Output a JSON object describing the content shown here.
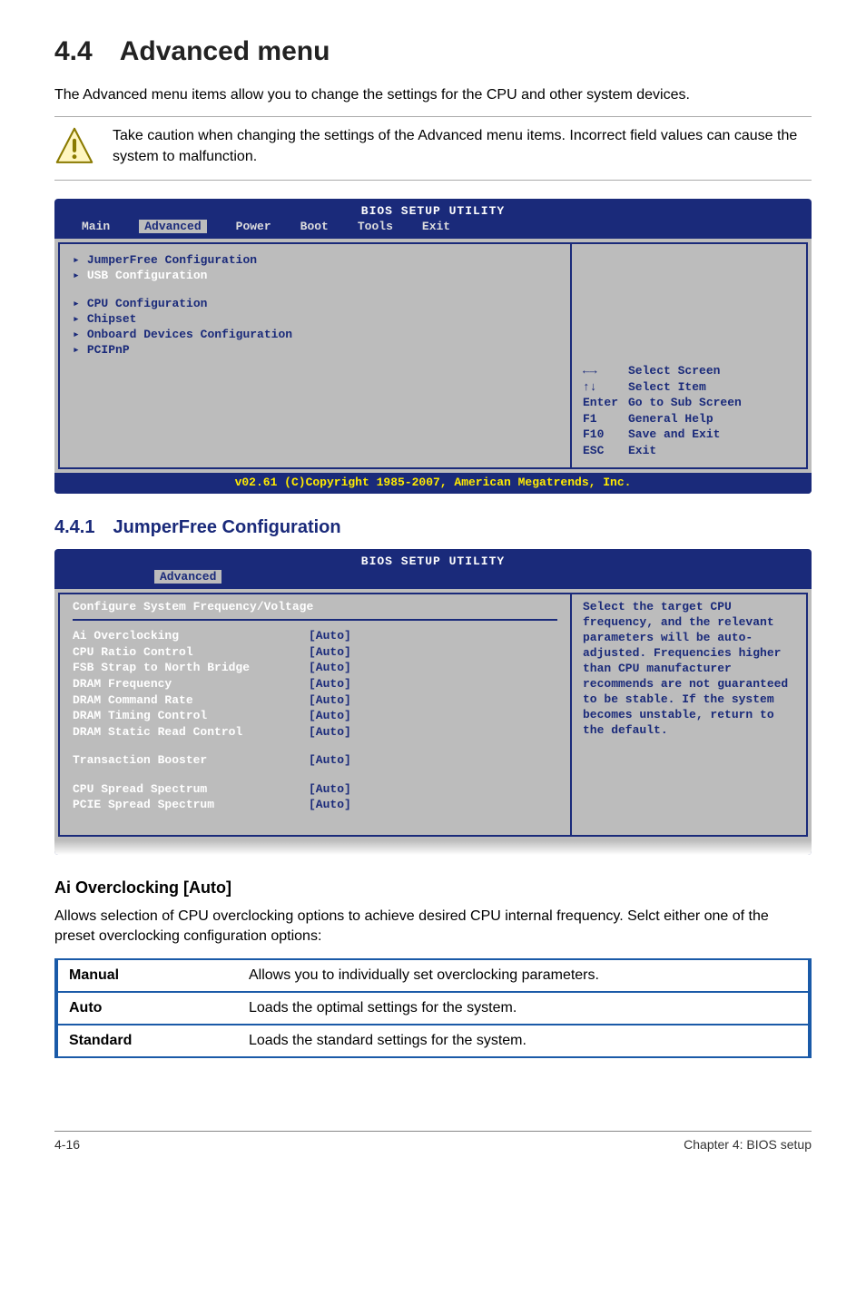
{
  "headings": {
    "main": "4.4 Advanced menu",
    "sub1": "4.4.1 JumperFree Configuration",
    "itemHeading": "Ai Overclocking [Auto]"
  },
  "paragraphs": {
    "intro": "The Advanced menu items allow you to change the settings for the CPU and other system devices.",
    "caution": "Take caution when changing the settings of the Advanced menu items. Incorrect field values can cause the system to malfunction.",
    "overclockDesc": "Allows selection of CPU overclocking options to achieve desired CPU internal frequency. Selct either one of the preset overclocking configuration options:"
  },
  "bios1": {
    "title": "BIOS SETUP UTILITY",
    "tabs": [
      "Main",
      "Advanced",
      "Power",
      "Boot",
      "Tools",
      "Exit"
    ],
    "activeTab": "Advanced",
    "left": [
      "JumperFree Configuration",
      "USB Configuration",
      "",
      "CPU Configuration",
      "Chipset",
      "Onboard Devices Configuration",
      "PCIPnP"
    ],
    "highlight": "USB Configuration",
    "help": [
      [
        "←→",
        "Select Screen"
      ],
      [
        "↑↓",
        "Select Item"
      ],
      [
        "Enter",
        "Go to Sub Screen"
      ],
      [
        "F1",
        "General Help"
      ],
      [
        "F10",
        "Save and Exit"
      ],
      [
        "ESC",
        "Exit"
      ]
    ],
    "footer": "v02.61 (C)Copyright 1985-2007, American Megatrends, Inc."
  },
  "bios2": {
    "title": "BIOS SETUP UTILITY",
    "activeTab": "Advanced",
    "section": "Configure System Frequency/Voltage",
    "rows": [
      [
        "Ai Overclocking",
        "[Auto]"
      ],
      [
        "CPU Ratio Control",
        "[Auto]"
      ],
      [
        "FSB Strap to North Bridge",
        "[Auto]"
      ],
      [
        "DRAM Frequency",
        "[Auto]"
      ],
      [
        "DRAM Command Rate",
        "[Auto]"
      ],
      [
        "DRAM Timing Control",
        "[Auto]"
      ],
      [
        "DRAM Static Read Control",
        "[Auto]"
      ]
    ],
    "rows2": [
      [
        "Transaction Booster",
        "[Auto]"
      ]
    ],
    "rows3": [
      [
        "CPU Spread Spectrum",
        "[Auto]"
      ],
      [
        "PCIE Spread Spectrum",
        "[Auto]"
      ]
    ],
    "helpText": "Select the target CPU frequency, and the relevant parameters will be auto-adjusted. Frequencies higher than CPU manufacturer recommends are not guaranteed to be stable. If the system becomes unstable, return to the default."
  },
  "optionsTable": [
    [
      "Manual",
      "Allows you to individually set overclocking parameters."
    ],
    [
      "Auto",
      "Loads the optimal settings for the system."
    ],
    [
      "Standard",
      "Loads the standard settings for the system."
    ]
  ],
  "footer": {
    "left": "4-16",
    "right": "Chapter 4: BIOS setup"
  }
}
